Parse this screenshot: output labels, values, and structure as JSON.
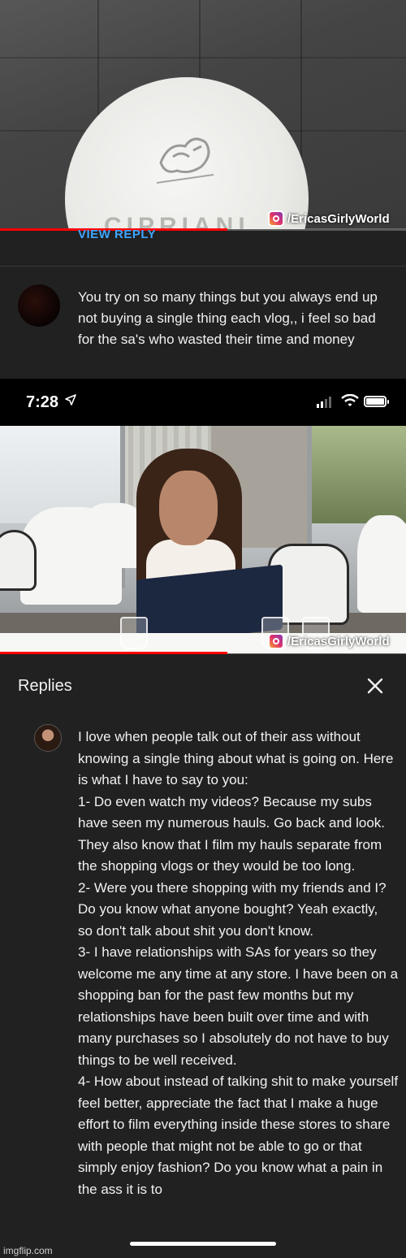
{
  "video_top": {
    "watermark": "/EricasGirlyWorld",
    "sign_text": "CIPRIANI",
    "progress": 0.56
  },
  "comment": {
    "view_reply_label": "VIEW REPLY",
    "text": "You try on so many things but you always end up not buying a single thing each vlog,, i feel so bad for the sa's who wasted their time and money"
  },
  "status_bar": {
    "time": "7:28",
    "location_icon": "location-arrow-icon",
    "signal_icon": "signal-bars-icon",
    "wifi_icon": "wifi-icon",
    "battery_icon": "battery-icon"
  },
  "video_bottom": {
    "watermark": "/EricasGirlyWorld",
    "progress": 0.56
  },
  "replies": {
    "title": "Replies",
    "close_icon": "close-icon",
    "reply_text": "I love when people talk out of their ass without knowing a single thing about what is going on. Here is what I have to say to you:\n1- Do even watch my videos? Because my subs have seen my numerous hauls. Go back and look. They also know that I film my hauls separate from the shopping vlogs or they would be too long.\n2- Were you there shopping with my friends and I? Do you know what anyone bought? Yeah exactly,  so don't talk about shit you don't know.\n3- I have relationships with SAs for years so they welcome me any time at any store. I have been on a shopping ban for the past few months but my relationships have been built over time and with many purchases so I absolutely do not have to buy things to be well received.\n4- How about instead of talking shit to make yourself feel better, appreciate the fact that I make a huge effort to film everything inside these stores to share with people that might not be able to go or that simply enjoy fashion? Do you know what a pain in the ass it is to"
  },
  "footer": {
    "imgflip": "imgflip.com"
  },
  "colors": {
    "background": "#212121",
    "link_blue": "#3ea6ff",
    "progress_red": "#ff0000"
  }
}
